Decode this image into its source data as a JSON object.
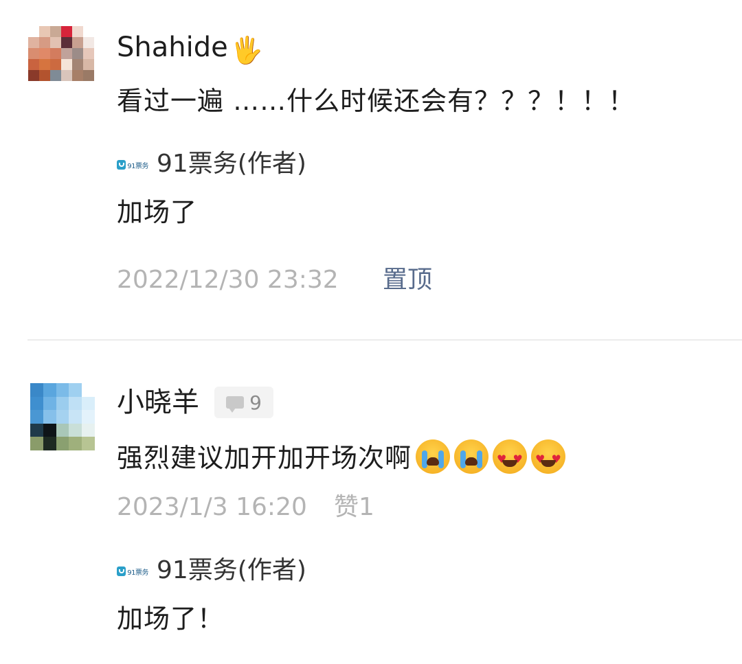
{
  "comments": [
    {
      "username": "Shahide",
      "username_icon": "raised-hand-icon",
      "text": "看过一遍 ……什么时候还会有？？？！！！",
      "author_name": "91票务(作者)",
      "author_logo_text": "91票务",
      "author_reply": "加场了",
      "timestamp": "2022/12/30 23:32",
      "pin_label": "置顶"
    },
    {
      "username": "小晓羊",
      "badge_count": "9",
      "text": "强烈建议加开加开场次啊",
      "emojis": [
        "loudly-crying-face-icon",
        "loudly-crying-face-icon",
        "heart-eyes-face-icon",
        "heart-eyes-face-icon"
      ],
      "timestamp": "2023/1/3 16:20",
      "like_label": "赞1",
      "author_name": "91票务(作者)",
      "author_logo_text": "91票务",
      "author_reply": "加场了！"
    }
  ],
  "colors": {
    "pin": "#586b8c",
    "meta": "#b4b4b4",
    "divider": "#ececec",
    "logo": "#2a9fc9"
  }
}
